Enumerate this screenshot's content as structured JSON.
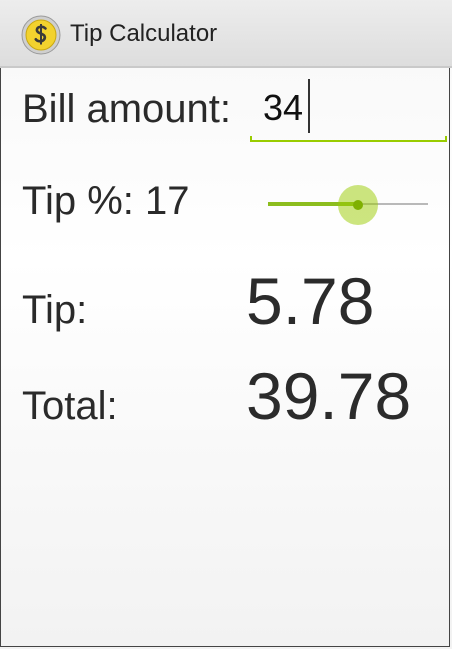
{
  "app": {
    "title": "Tip Calculator",
    "icon": "dollar-coin-icon"
  },
  "bill": {
    "label": "Bill amount:",
    "value": "34"
  },
  "tip_percent": {
    "label": "Tip %: 17",
    "value": 17,
    "slider_fraction": 0.56
  },
  "results": {
    "tip_label": "Tip:",
    "tip_value": "5.78",
    "total_label": "Total:",
    "total_value": "39.78"
  },
  "colors": {
    "accent": "#99cc00",
    "coin_gold": "#f2d22e",
    "action_bar": "#e4e4e4"
  }
}
